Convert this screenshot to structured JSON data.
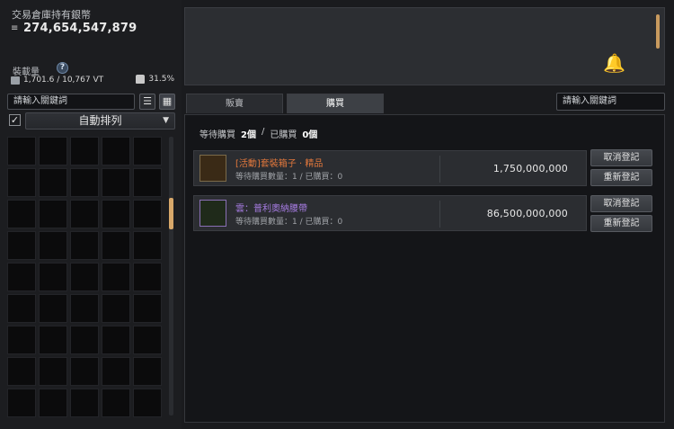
{
  "warehouse": {
    "title": "交易倉庫持有銀幣",
    "money": "274,654,547,879",
    "capacity_label": "裝載量",
    "help_icon": "?",
    "capacity_value": "1,701.6 / 10,767 VT",
    "percent": "31.5%",
    "search_placeholder": "請輸入關鍵詞",
    "sort_label": "自動排列",
    "slot_count": 45
  },
  "panel": {
    "tabs": [
      {
        "label": "販賣"
      },
      {
        "label": "購買"
      }
    ],
    "search_placeholder": "請輸入關鍵詞",
    "status": {
      "pending_label": "等待購買",
      "pending_count": "2個",
      "sep": "/",
      "done_label": "已購買",
      "done_count": "0個"
    },
    "orders": [
      {
        "name": "[活動]套裝箱子 · 精品",
        "name_color": "#e0773c",
        "sub": "等待購買數量：1 / 已購買：0",
        "price": "1,750,000,000",
        "icon": "treasure-chest-icon",
        "cancel_label": "取消登記",
        "reregister_label": "重新登記"
      },
      {
        "name": "雲：普利奧納腰帶",
        "name_color": "#a57be0",
        "sub": "等待購買數量：1 / 已購買：0",
        "price": "86,500,000,000",
        "icon": "belt-icon",
        "cancel_label": "取消登記",
        "reregister_label": "重新登記"
      }
    ]
  }
}
